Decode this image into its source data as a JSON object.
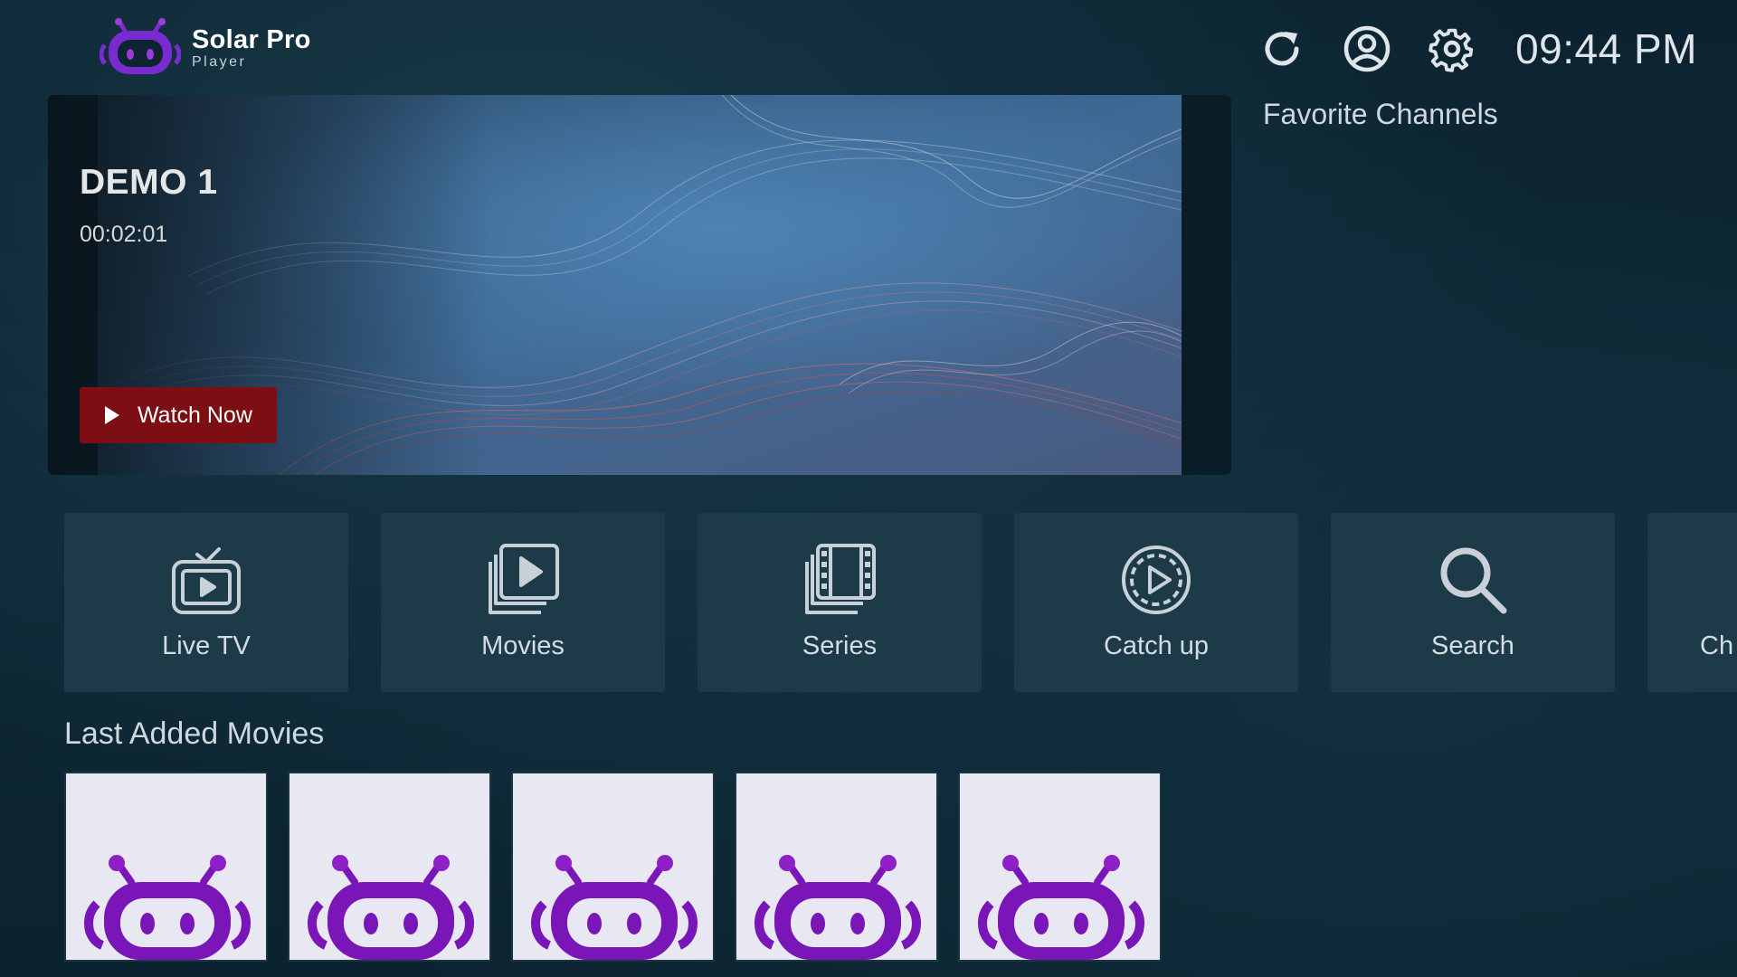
{
  "app": {
    "title": "Solar Pro",
    "subtitle": "Player",
    "brand_color": "#7a2bd0"
  },
  "header": {
    "icons": [
      "refresh-icon",
      "account-icon",
      "settings-icon"
    ],
    "clock": "09:44 PM"
  },
  "hero": {
    "title": "DEMO 1",
    "time": "00:02:01",
    "watch_label": "Watch Now",
    "watch_color": "#7d0f14"
  },
  "favorites": {
    "title": "Favorite Channels"
  },
  "menu": {
    "items": [
      {
        "label": "Live TV",
        "icon": "live-tv-icon"
      },
      {
        "label": "Movies",
        "icon": "movies-icon"
      },
      {
        "label": "Series",
        "icon": "series-icon"
      },
      {
        "label": "Catch up",
        "icon": "catch-up-icon"
      },
      {
        "label": "Search",
        "icon": "search-icon"
      },
      {
        "label": "Ch",
        "icon": ""
      }
    ]
  },
  "last_added": {
    "title": "Last Added Movies",
    "count": 5
  }
}
